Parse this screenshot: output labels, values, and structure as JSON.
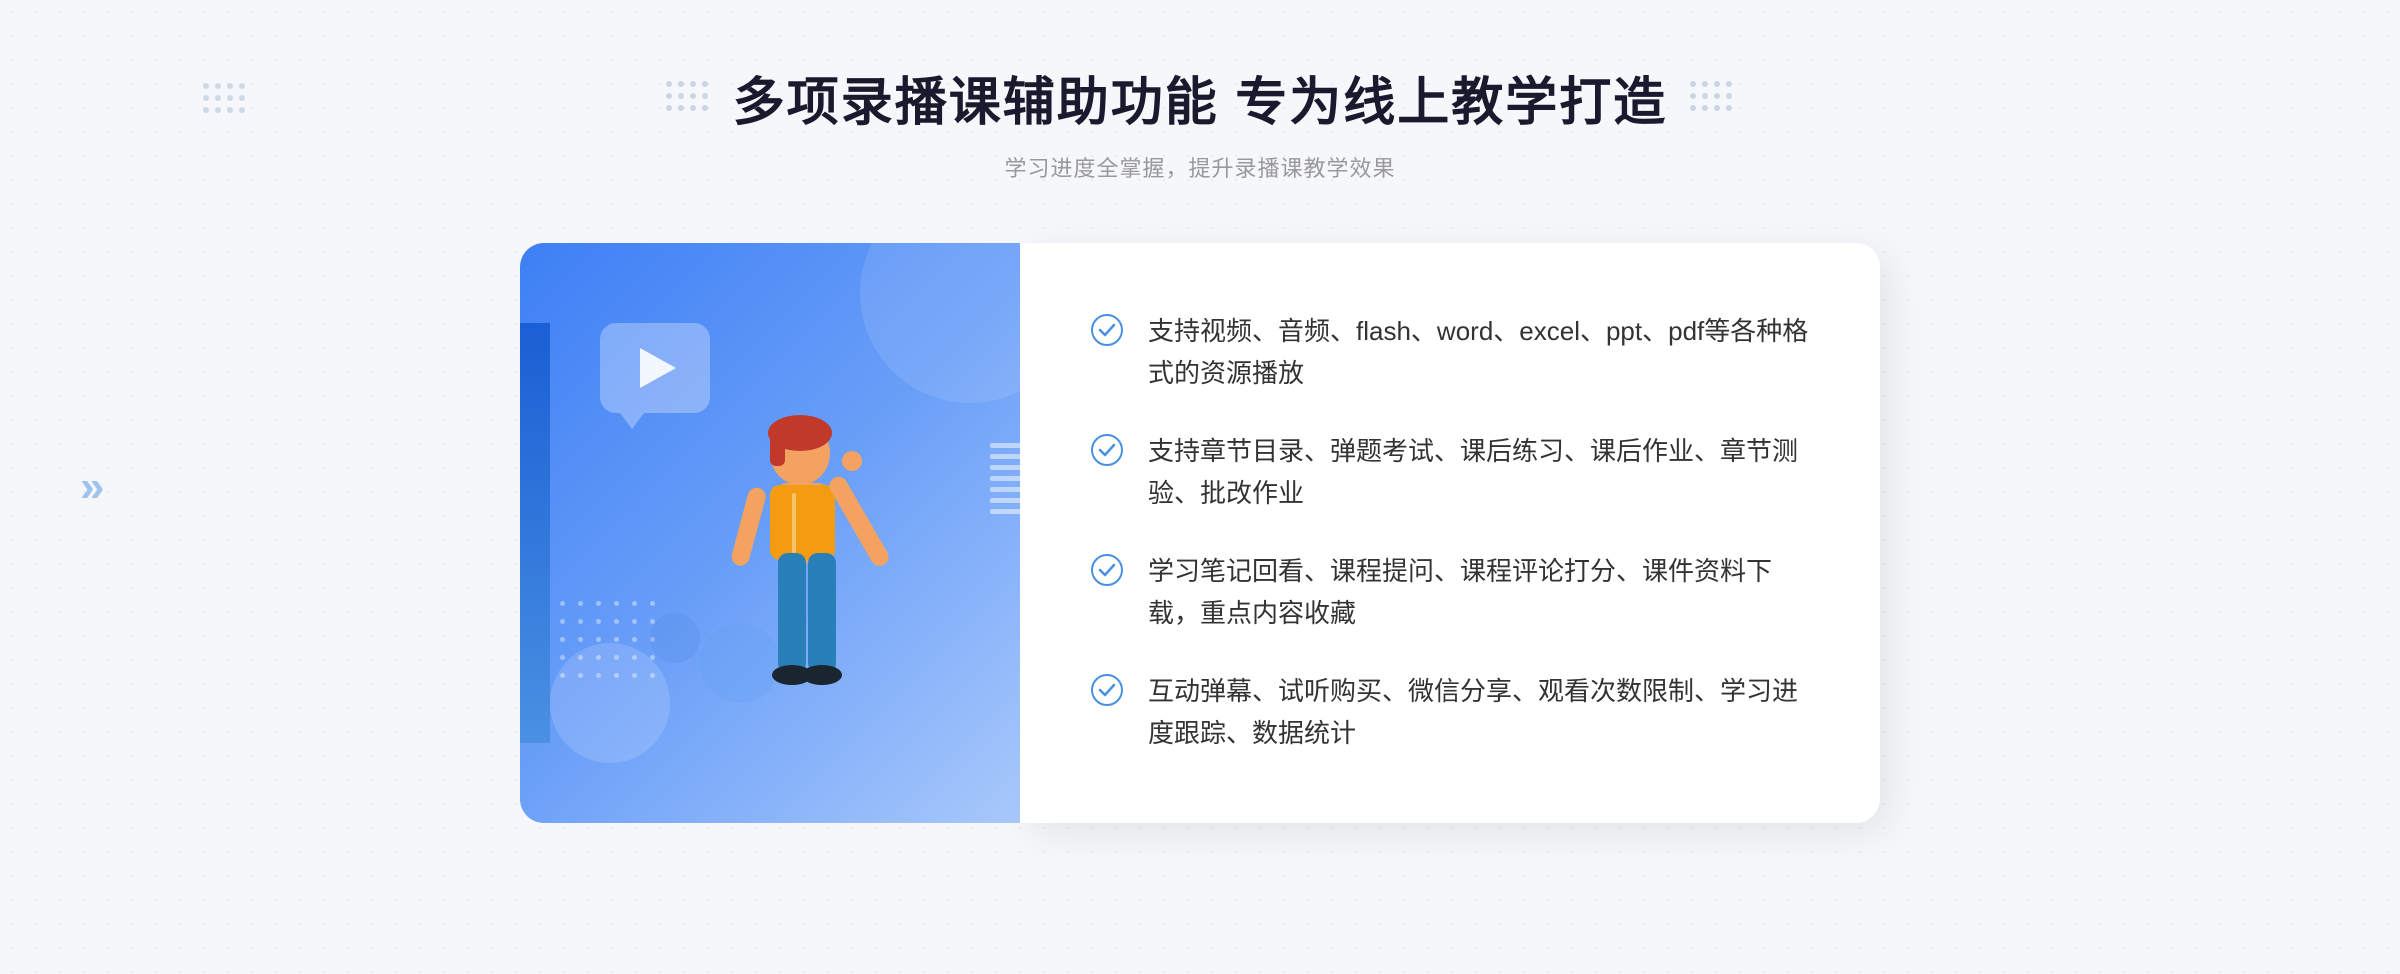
{
  "header": {
    "title": "多项录播课辅助功能 专为线上教学打造",
    "subtitle": "学习进度全掌握，提升录播课教学效果"
  },
  "features": [
    {
      "id": "feature-1",
      "text": "支持视频、音频、flash、word、excel、ppt、pdf等各种格式的资源播放"
    },
    {
      "id": "feature-2",
      "text": "支持章节目录、弹题考试、课后练习、课后作业、章节测验、批改作业"
    },
    {
      "id": "feature-3",
      "text": "学习笔记回看、课程提问、课程评论打分、课件资料下载，重点内容收藏"
    },
    {
      "id": "feature-4",
      "text": "互动弹幕、试听购买、微信分享、观看次数限制、学习进度跟踪、数据统计"
    }
  ],
  "decoration": {
    "arrow_left": "»",
    "check_color": "#4a90e2"
  }
}
